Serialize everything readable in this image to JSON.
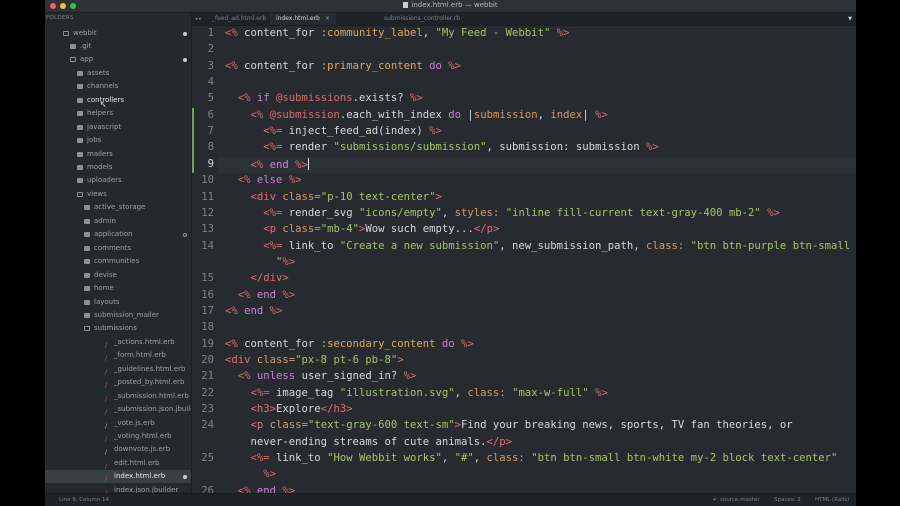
{
  "window": {
    "title": "index.html.erb — webbit"
  },
  "sidebar": {
    "header": "FOLDERS",
    "rows": [
      {
        "label": "webbit",
        "depth": 0,
        "kind": "folder-open",
        "dot": "filled"
      },
      {
        "label": ".git",
        "depth": 1,
        "kind": "folder"
      },
      {
        "label": "app",
        "depth": 1,
        "kind": "folder-open",
        "dot": "filled"
      },
      {
        "label": "assets",
        "depth": 2,
        "kind": "folder"
      },
      {
        "label": "channels",
        "depth": 2,
        "kind": "folder"
      },
      {
        "label": "controllers",
        "depth": 2,
        "kind": "folder",
        "hover": true
      },
      {
        "label": "helpers",
        "depth": 2,
        "kind": "folder"
      },
      {
        "label": "javascript",
        "depth": 2,
        "kind": "folder"
      },
      {
        "label": "jobs",
        "depth": 2,
        "kind": "folder"
      },
      {
        "label": "mailers",
        "depth": 2,
        "kind": "folder"
      },
      {
        "label": "models",
        "depth": 2,
        "kind": "folder"
      },
      {
        "label": "uploaders",
        "depth": 2,
        "kind": "folder"
      },
      {
        "label": "views",
        "depth": 2,
        "kind": "folder-open"
      },
      {
        "label": "active_storage",
        "depth": 3,
        "kind": "folder"
      },
      {
        "label": "admin",
        "depth": 3,
        "kind": "folder"
      },
      {
        "label": "application",
        "depth": 3,
        "kind": "folder",
        "dot": "ring"
      },
      {
        "label": "comments",
        "depth": 3,
        "kind": "folder"
      },
      {
        "label": "communities",
        "depth": 3,
        "kind": "folder"
      },
      {
        "label": "devise",
        "depth": 3,
        "kind": "folder"
      },
      {
        "label": "home",
        "depth": 3,
        "kind": "folder"
      },
      {
        "label": "layouts",
        "depth": 3,
        "kind": "folder"
      },
      {
        "label": "submission_mailer",
        "depth": 3,
        "kind": "folder"
      },
      {
        "label": "submissions",
        "depth": 3,
        "kind": "folder-open"
      },
      {
        "label": "_actions.html.erb",
        "depth": 4,
        "kind": "erb"
      },
      {
        "label": "_form.html.erb",
        "depth": 4,
        "kind": "erb"
      },
      {
        "label": "_guidelines.html.erb",
        "depth": 4,
        "kind": "erb"
      },
      {
        "label": "_posted_by.html.erb",
        "depth": 4,
        "kind": "erb"
      },
      {
        "label": "_submission.html.erb",
        "depth": 4,
        "kind": "erb"
      },
      {
        "label": "_submission.json.jbuilder",
        "depth": 4,
        "kind": "erb"
      },
      {
        "label": "_vote.js.erb",
        "depth": 4,
        "kind": "js"
      },
      {
        "label": "_voting.html.erb",
        "depth": 4,
        "kind": "erb"
      },
      {
        "label": "downvote.js.erb",
        "depth": 4,
        "kind": "js"
      },
      {
        "label": "edit.html.erb",
        "depth": 4,
        "kind": "erb"
      },
      {
        "label": "index.html.erb",
        "depth": 4,
        "kind": "erb",
        "selected": true,
        "dot": "filled"
      },
      {
        "label": "index.json.jbuilder",
        "depth": 4,
        "kind": "erb"
      }
    ]
  },
  "tabs": [
    {
      "label": "_feed_ad.html.erb",
      "active": false
    },
    {
      "label": "index.html.erb",
      "active": true,
      "close": "×"
    },
    {
      "label": "submissions_controller.rb",
      "active": false
    }
  ],
  "editor": {
    "current_line": 9,
    "modified_lines": [
      6,
      9
    ],
    "lines": [
      {
        "n": "1",
        "segs": [
          [
            "d",
            "<%"
          ],
          [
            "p",
            " content_for "
          ],
          [
            "s",
            ":community_label"
          ],
          [
            "p",
            ", "
          ],
          [
            "q",
            "\"My Feed - Webbit\""
          ],
          [
            "p",
            " "
          ],
          [
            "d",
            "%>"
          ]
        ]
      },
      {
        "n": "2",
        "segs": []
      },
      {
        "n": "3",
        "segs": [
          [
            "d",
            "<%"
          ],
          [
            "p",
            " content_for "
          ],
          [
            "s",
            ":primary_content"
          ],
          [
            "k",
            " do "
          ],
          [
            "d",
            "%>"
          ]
        ]
      },
      {
        "n": "4",
        "segs": []
      },
      {
        "n": "5",
        "segs": [
          [
            "p",
            "  "
          ],
          [
            "d",
            "<%"
          ],
          [
            "k",
            " if "
          ],
          [
            "i",
            "@submissions"
          ],
          [
            "p",
            ".exists? "
          ],
          [
            "d",
            "%>"
          ]
        ]
      },
      {
        "n": "6",
        "segs": [
          [
            "p",
            "    "
          ],
          [
            "d",
            "<%"
          ],
          [
            "p",
            " "
          ],
          [
            "i",
            "@submission"
          ],
          [
            "p",
            ".each_with_index "
          ],
          [
            "k",
            "do"
          ],
          [
            "p",
            " |"
          ],
          [
            "b",
            "submission"
          ],
          [
            "p",
            ", "
          ],
          [
            "b",
            "index"
          ],
          [
            "p",
            "| "
          ],
          [
            "d",
            "%>"
          ]
        ]
      },
      {
        "n": "7",
        "segs": [
          [
            "p",
            "      "
          ],
          [
            "d",
            "<%="
          ],
          [
            "p",
            " inject_feed_ad(index) "
          ],
          [
            "d",
            "%>"
          ]
        ]
      },
      {
        "n": "8",
        "segs": [
          [
            "p",
            "      "
          ],
          [
            "d",
            "<%="
          ],
          [
            "p",
            " render "
          ],
          [
            "q",
            "\"submissions/submission\""
          ],
          [
            "p",
            ", submission: submission "
          ],
          [
            "d",
            "%>"
          ]
        ]
      },
      {
        "n": "9",
        "segs": [
          [
            "p",
            "    "
          ],
          [
            "d",
            "<%"
          ],
          [
            "k",
            " end "
          ],
          [
            "d",
            "%>"
          ]
        ],
        "caret": true
      },
      {
        "n": "10",
        "segs": [
          [
            "p",
            "  "
          ],
          [
            "d",
            "<%"
          ],
          [
            "k",
            " else "
          ],
          [
            "d",
            "%>"
          ]
        ]
      },
      {
        "n": "11",
        "segs": [
          [
            "p",
            "    "
          ],
          [
            "t",
            "<div"
          ],
          [
            "a",
            " class="
          ],
          [
            "q",
            "\"p-10 text-center\""
          ],
          [
            "t",
            ">"
          ]
        ]
      },
      {
        "n": "12",
        "segs": [
          [
            "p",
            "      "
          ],
          [
            "d",
            "<%="
          ],
          [
            "p",
            " render_svg "
          ],
          [
            "q",
            "\"icons/empty\""
          ],
          [
            "p",
            ", "
          ],
          [
            "a",
            "styles: "
          ],
          [
            "q",
            "\"inline fill-current text-gray-400 mb-2\""
          ],
          [
            "p",
            " "
          ],
          [
            "d",
            "%>"
          ]
        ]
      },
      {
        "n": "13",
        "segs": [
          [
            "p",
            "      "
          ],
          [
            "t",
            "<p"
          ],
          [
            "a",
            " class="
          ],
          [
            "q",
            "\"mb-4\""
          ],
          [
            "t",
            ">"
          ],
          [
            "p",
            "Wow such empty..."
          ],
          [
            "t",
            "</p>"
          ]
        ]
      },
      {
        "n": "14",
        "segs": [
          [
            "p",
            "      "
          ],
          [
            "d",
            "<%="
          ],
          [
            "p",
            " link_to "
          ],
          [
            "q",
            "\"Create a new submission\""
          ],
          [
            "p",
            ", new_submission_path, "
          ],
          [
            "a",
            "class: "
          ],
          [
            "q",
            "\"btn btn-purple btn-small"
          ]
        ]
      },
      {
        "n": "",
        "segs": [
          [
            "q",
            "        \""
          ],
          [
            "d",
            "%>"
          ]
        ]
      },
      {
        "n": "15",
        "segs": [
          [
            "p",
            "    "
          ],
          [
            "t",
            "</div>"
          ]
        ]
      },
      {
        "n": "16",
        "segs": [
          [
            "p",
            "  "
          ],
          [
            "d",
            "<%"
          ],
          [
            "k",
            " end "
          ],
          [
            "d",
            "%>"
          ]
        ]
      },
      {
        "n": "17",
        "segs": [
          [
            "d",
            "<%"
          ],
          [
            "k",
            " end "
          ],
          [
            "d",
            "%>"
          ]
        ]
      },
      {
        "n": "18",
        "segs": []
      },
      {
        "n": "19",
        "segs": [
          [
            "d",
            "<%"
          ],
          [
            "p",
            " content_for "
          ],
          [
            "s",
            ":secondary_content"
          ],
          [
            "k",
            " do "
          ],
          [
            "d",
            "%>"
          ]
        ]
      },
      {
        "n": "20",
        "segs": [
          [
            "t",
            "<div"
          ],
          [
            "a",
            " class="
          ],
          [
            "q",
            "\"px-8 pt-6 pb-8\""
          ],
          [
            "t",
            ">"
          ]
        ]
      },
      {
        "n": "21",
        "segs": [
          [
            "p",
            "  "
          ],
          [
            "d",
            "<%"
          ],
          [
            "k",
            " unless "
          ],
          [
            "p",
            "user_signed_in? "
          ],
          [
            "d",
            "%>"
          ]
        ]
      },
      {
        "n": "22",
        "segs": [
          [
            "p",
            "    "
          ],
          [
            "d",
            "<%="
          ],
          [
            "p",
            " image_tag "
          ],
          [
            "q",
            "\"illustration.svg\""
          ],
          [
            "p",
            ", "
          ],
          [
            "a",
            "class: "
          ],
          [
            "q",
            "\"max-w-full\""
          ],
          [
            "p",
            " "
          ],
          [
            "d",
            "%>"
          ]
        ]
      },
      {
        "n": "23",
        "segs": [
          [
            "p",
            "    "
          ],
          [
            "t",
            "<h3>"
          ],
          [
            "p",
            "Explore"
          ],
          [
            "t",
            "</h3>"
          ]
        ]
      },
      {
        "n": "24",
        "segs": [
          [
            "p",
            "    "
          ],
          [
            "t",
            "<p"
          ],
          [
            "a",
            " class="
          ],
          [
            "q",
            "\"text-gray-600 text-sm\""
          ],
          [
            "t",
            ">"
          ],
          [
            "p",
            "Find your breaking news, sports, TV fan theories, or"
          ]
        ]
      },
      {
        "n": "",
        "segs": [
          [
            "p",
            "    never-ending streams of cute animals."
          ],
          [
            "t",
            "</p>"
          ]
        ]
      },
      {
        "n": "25",
        "segs": [
          [
            "p",
            "    "
          ],
          [
            "d",
            "<%="
          ],
          [
            "p",
            " link_to "
          ],
          [
            "q",
            "\"How Webbit works\""
          ],
          [
            "p",
            ", "
          ],
          [
            "q",
            "\"#\""
          ],
          [
            "p",
            ", "
          ],
          [
            "a",
            "class: "
          ],
          [
            "q",
            "\"btn btn-small btn-white my-2 block text-center\""
          ]
        ]
      },
      {
        "n": "",
        "segs": [
          [
            "p",
            "      "
          ],
          [
            "d",
            "%>"
          ]
        ]
      },
      {
        "n": "26",
        "segs": [
          [
            "p",
            "  "
          ],
          [
            "d",
            "<%"
          ],
          [
            "k",
            " end "
          ],
          [
            "d",
            "%>"
          ]
        ]
      }
    ]
  },
  "statusbar": {
    "position": "Line 9, Column 14",
    "branch": "source-master",
    "branch_icon": "git-branch-icon",
    "spaces": "Spaces: 2",
    "syntax": "HTML (Rails)"
  },
  "colors": {
    "delim": "#d56b6b",
    "string": "#a3c46a",
    "symbol": "#d9a95b",
    "keyword": "#c681d4",
    "tag": "#e06c75",
    "attr": "#d19a66",
    "gutter_mod": "#6aa84f"
  }
}
